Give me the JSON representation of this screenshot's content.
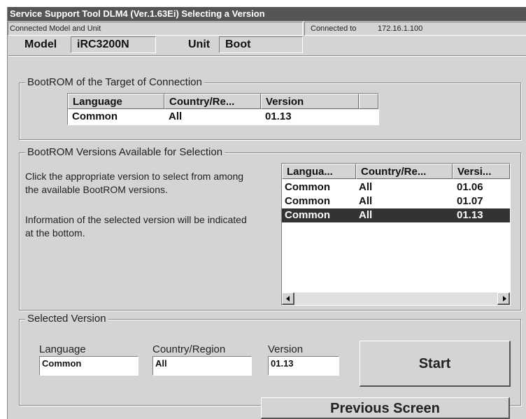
{
  "window": {
    "title": "Service Support Tool DLM4 (Ver.1.63Ei) Selecting a Version"
  },
  "connection": {
    "section_label": "Connected Model and Unit",
    "connected_to_label": "Connected to",
    "ip": "172.16.1.100",
    "model_label": "Model",
    "model_value": "iRC3200N",
    "unit_label": "Unit",
    "unit_value": "Boot"
  },
  "target_bootrom": {
    "title": "BootROM of the Target of Connection",
    "columns": [
      "Language",
      "Country/Re...",
      "Version"
    ],
    "rows": [
      {
        "language": "Common",
        "country": "All",
        "version": "01.13"
      }
    ]
  },
  "available": {
    "title": "BootROM Versions Available for Selection",
    "instruction_1": "Click the appropriate version to select from among the available BootROM versions.",
    "instruction_2": "Information of the selected version will be indicated at the bottom.",
    "columns": [
      "Langua...",
      "Country/Re...",
      "Versi..."
    ],
    "rows": [
      {
        "language": "Common",
        "country": "All",
        "version": "01.06",
        "selected": false
      },
      {
        "language": "Common",
        "country": "All",
        "version": "01.07",
        "selected": false
      },
      {
        "language": "Common",
        "country": "All",
        "version": "01.13",
        "selected": true
      }
    ],
    "scroll_left_icon": "arrow-left-icon",
    "scroll_right_icon": "arrow-right-icon"
  },
  "selected": {
    "title": "Selected Version",
    "language_label": "Language",
    "language_value": "Common",
    "country_label": "Country/Region",
    "country_value": "All",
    "version_label": "Version",
    "version_value": "01.13",
    "start_label": "Start"
  },
  "previous_label": "Previous Screen",
  "colors": {
    "title_bg": "#555555",
    "window_bg": "#d4d4d4",
    "selection_bg": "#333333",
    "selection_text": "#ffffff"
  }
}
